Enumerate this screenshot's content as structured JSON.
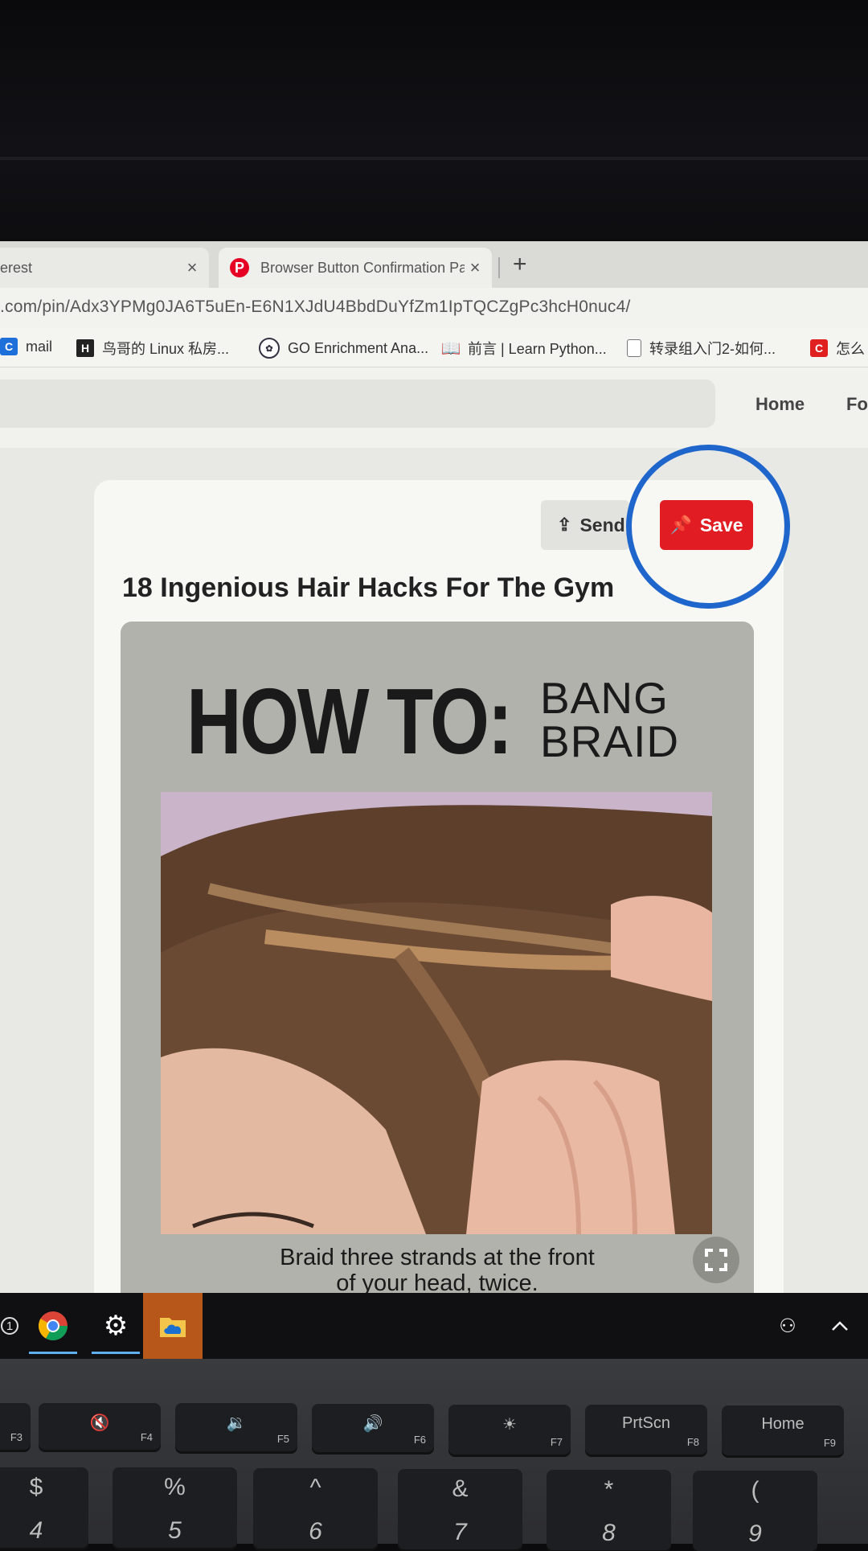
{
  "browser": {
    "tabs": [
      {
        "label": "erest",
        "close": "×"
      },
      {
        "label": "Browser Button Confirmation Pa",
        "close": "×"
      }
    ],
    "new_tab": "+",
    "url": ".com/pin/Adx3YPMg0JA6T5uEn-E6N1XJdU4BbdDuYfZm1IpTQCZgPc3hcH0nuc4/",
    "bookmarks": [
      {
        "label": "mail",
        "icon": "c-icon"
      },
      {
        "label": "鸟哥的 Linux 私房...",
        "icon": "book-icon"
      },
      {
        "label": "GO Enrichment Ana...",
        "icon": "cluster-icon"
      },
      {
        "label": "前言 | Learn Python...",
        "icon": "open-book-icon"
      },
      {
        "label": "转录组入门2-如何...",
        "icon": "document-icon"
      },
      {
        "label": "怎么",
        "icon": "c-red-icon"
      }
    ]
  },
  "site": {
    "nav": {
      "home": "Home",
      "following": "Fo"
    }
  },
  "pin": {
    "send_label": "Send",
    "save_label": "Save",
    "title": "18 Ingenious Hair Hacks For The Gym",
    "image": {
      "heading": "HOW TO:",
      "sub1": "BANG",
      "sub2": "BRAID",
      "caption_line1": "Braid three strands at the front",
      "caption_line2": "of your head, twice."
    }
  },
  "taskbar": {
    "badge": "1",
    "items": [
      "chrome-icon",
      "settings-icon",
      "onedrive-folder-icon"
    ]
  },
  "keyboard": {
    "fkeys": [
      {
        "main": "",
        "fn": "F3"
      },
      {
        "main": "🔇",
        "fn": "F4"
      },
      {
        "main": "🔉",
        "fn": "F5"
      },
      {
        "main": "🔊",
        "fn": "F6"
      },
      {
        "main": "☀",
        "fn": "F7"
      },
      {
        "main": "PrtScn",
        "fn": "F8"
      },
      {
        "main": "Home",
        "fn": "F9"
      }
    ],
    "numkeys": [
      {
        "top": "$",
        "bot": "4"
      },
      {
        "top": "%",
        "bot": "5"
      },
      {
        "top": "^",
        "bot": "6"
      },
      {
        "top": "&",
        "bot": "7"
      },
      {
        "top": "*",
        "bot": "8"
      },
      {
        "top": "(",
        "bot": "9"
      }
    ]
  },
  "colors": {
    "save_red": "#e11d23",
    "highlight_blue": "#1f66cc",
    "pinterest_red": "#e60023"
  }
}
